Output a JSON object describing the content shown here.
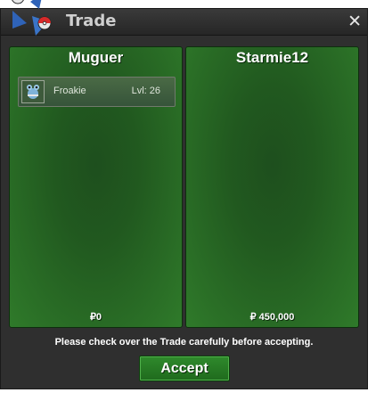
{
  "window": {
    "title": "Trade",
    "close_symbol": "✕"
  },
  "left_panel": {
    "player": "Muguer",
    "items": [
      {
        "name": "Froakie",
        "level": "Lvl: 26",
        "icon": "pokemon-icon"
      }
    ],
    "money": "₽0"
  },
  "right_panel": {
    "player": "Starmie12",
    "items": [],
    "money": "₽ 450,000"
  },
  "notice": "Please check over the Trade carefully before accepting.",
  "accept_label": "Accept",
  "colors": {
    "window_bg": "#2f2f2f",
    "panel_green": "#21591f",
    "accept_green": "#2f8a2c"
  }
}
